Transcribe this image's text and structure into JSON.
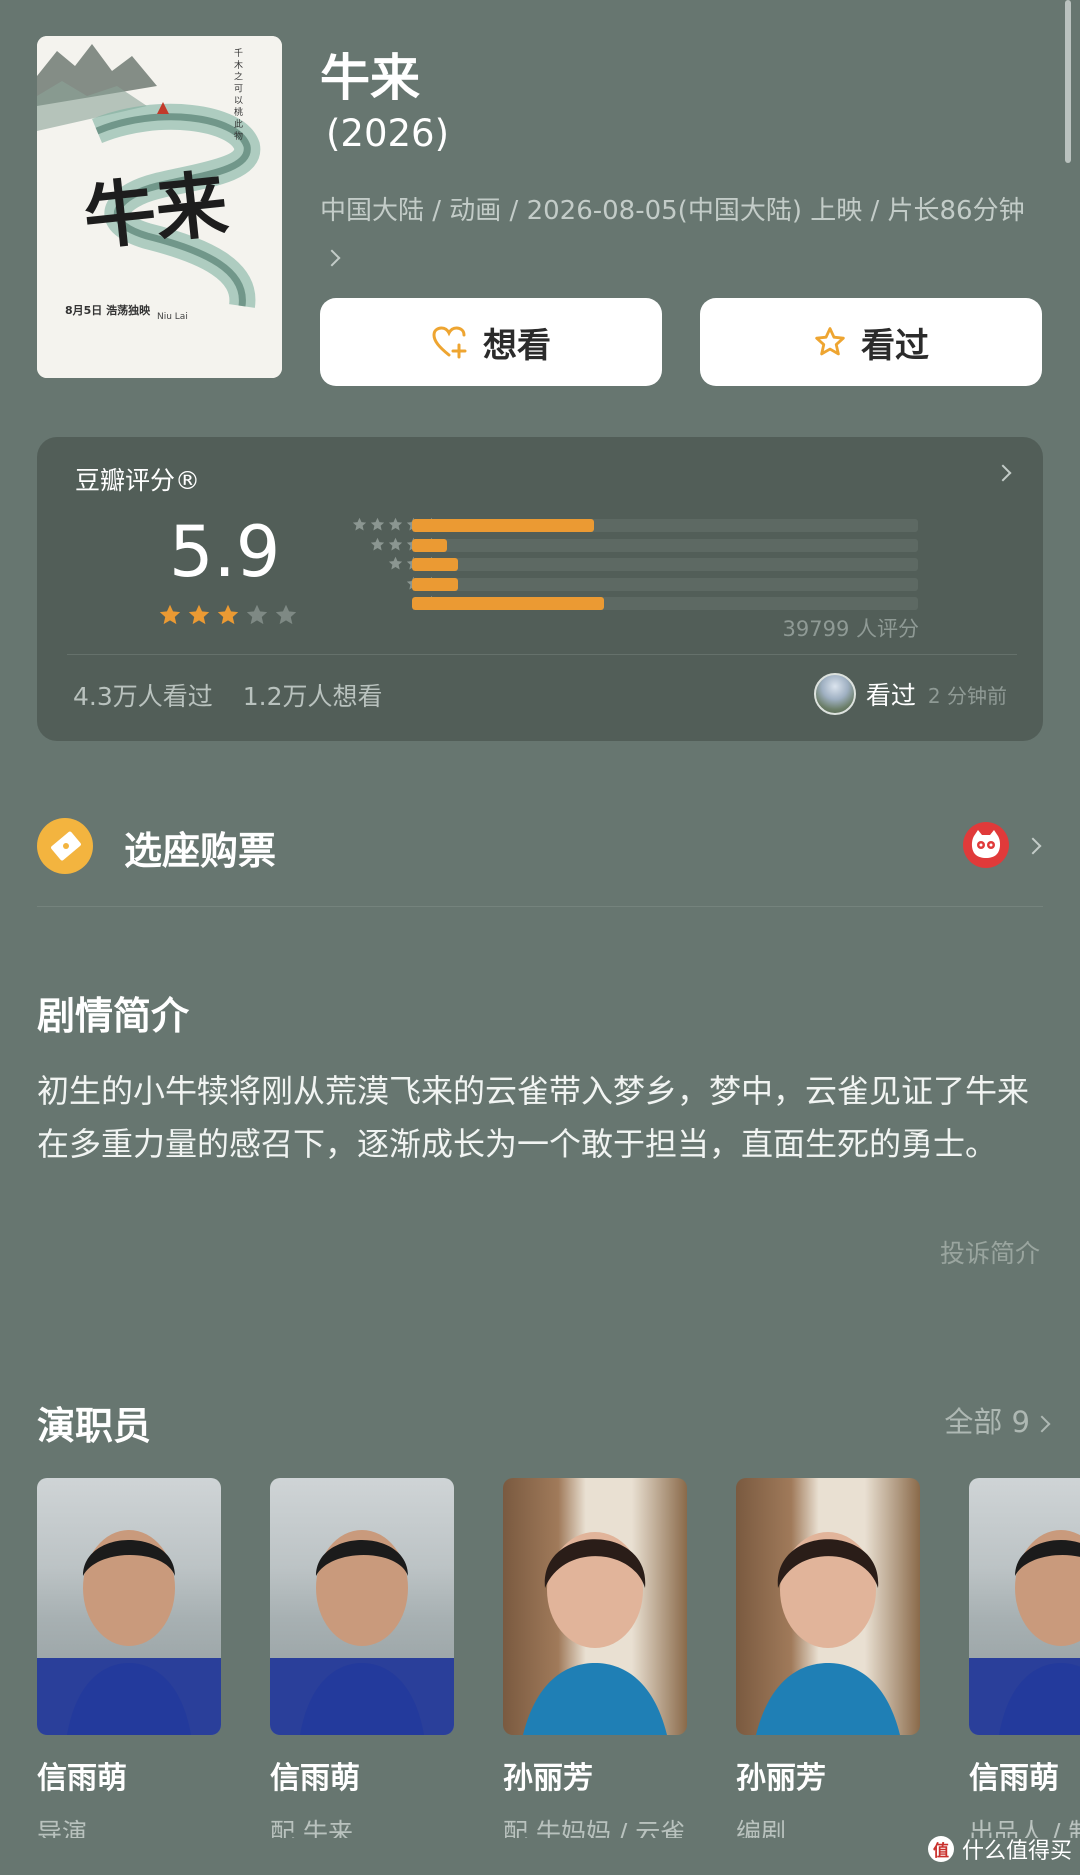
{
  "movie": {
    "title": "牛来",
    "year": "(2026)",
    "meta": "中国大陆 / 动画 / 2026-08-05(中国大陆) 上映 / 片长86分钟",
    "poster_title": "牛来",
    "poster_subtitle": "Niu Lai",
    "poster_date": "8月5日 浩荡独映"
  },
  "actions": {
    "want_label": "想看",
    "seen_label": "看过"
  },
  "rating": {
    "brand": "豆瓣评分®",
    "score": "5.9",
    "score_stars_filled": 3,
    "distribution": [
      {
        "stars": 5,
        "percent": 36
      },
      {
        "stars": 4,
        "percent": 7
      },
      {
        "stars": 3,
        "percent": 9
      },
      {
        "stars": 2,
        "percent": 9
      },
      {
        "stars": 1,
        "percent": 38
      }
    ],
    "count": "39799 人评分",
    "watched": "4.3万人看过",
    "want": "1.2万人想看",
    "friend_status": "看过",
    "friend_time": "2 分钟前"
  },
  "ticket": {
    "label": "选座购票"
  },
  "synopsis": {
    "title": "剧情简介",
    "text": "初生的小牛犊将刚从荒漠飞来的云雀带入梦乡，梦中，云雀见证了牛来在多重力量的感召下，逐渐成长为一个敢于担当，直面生死的勇士。",
    "report": "投诉简介"
  },
  "cast": {
    "title": "演职员",
    "see_all": "全部 9",
    "members": [
      {
        "name": "信雨萌",
        "role": "导演"
      },
      {
        "name": "信雨萌",
        "role": "配 牛来"
      },
      {
        "name": "孙丽芳",
        "role": "配 牛妈妈 / 云雀"
      },
      {
        "name": "孙丽芳",
        "role": "编剧"
      },
      {
        "name": "信雨萌",
        "role": "出品人 / 制"
      }
    ]
  },
  "watermark": {
    "badge": "值",
    "text": "什么值得买"
  },
  "colors": {
    "background": "#677670",
    "card": "#525e58",
    "accent": "#eb9a33",
    "ticket": "#f3b43f"
  }
}
